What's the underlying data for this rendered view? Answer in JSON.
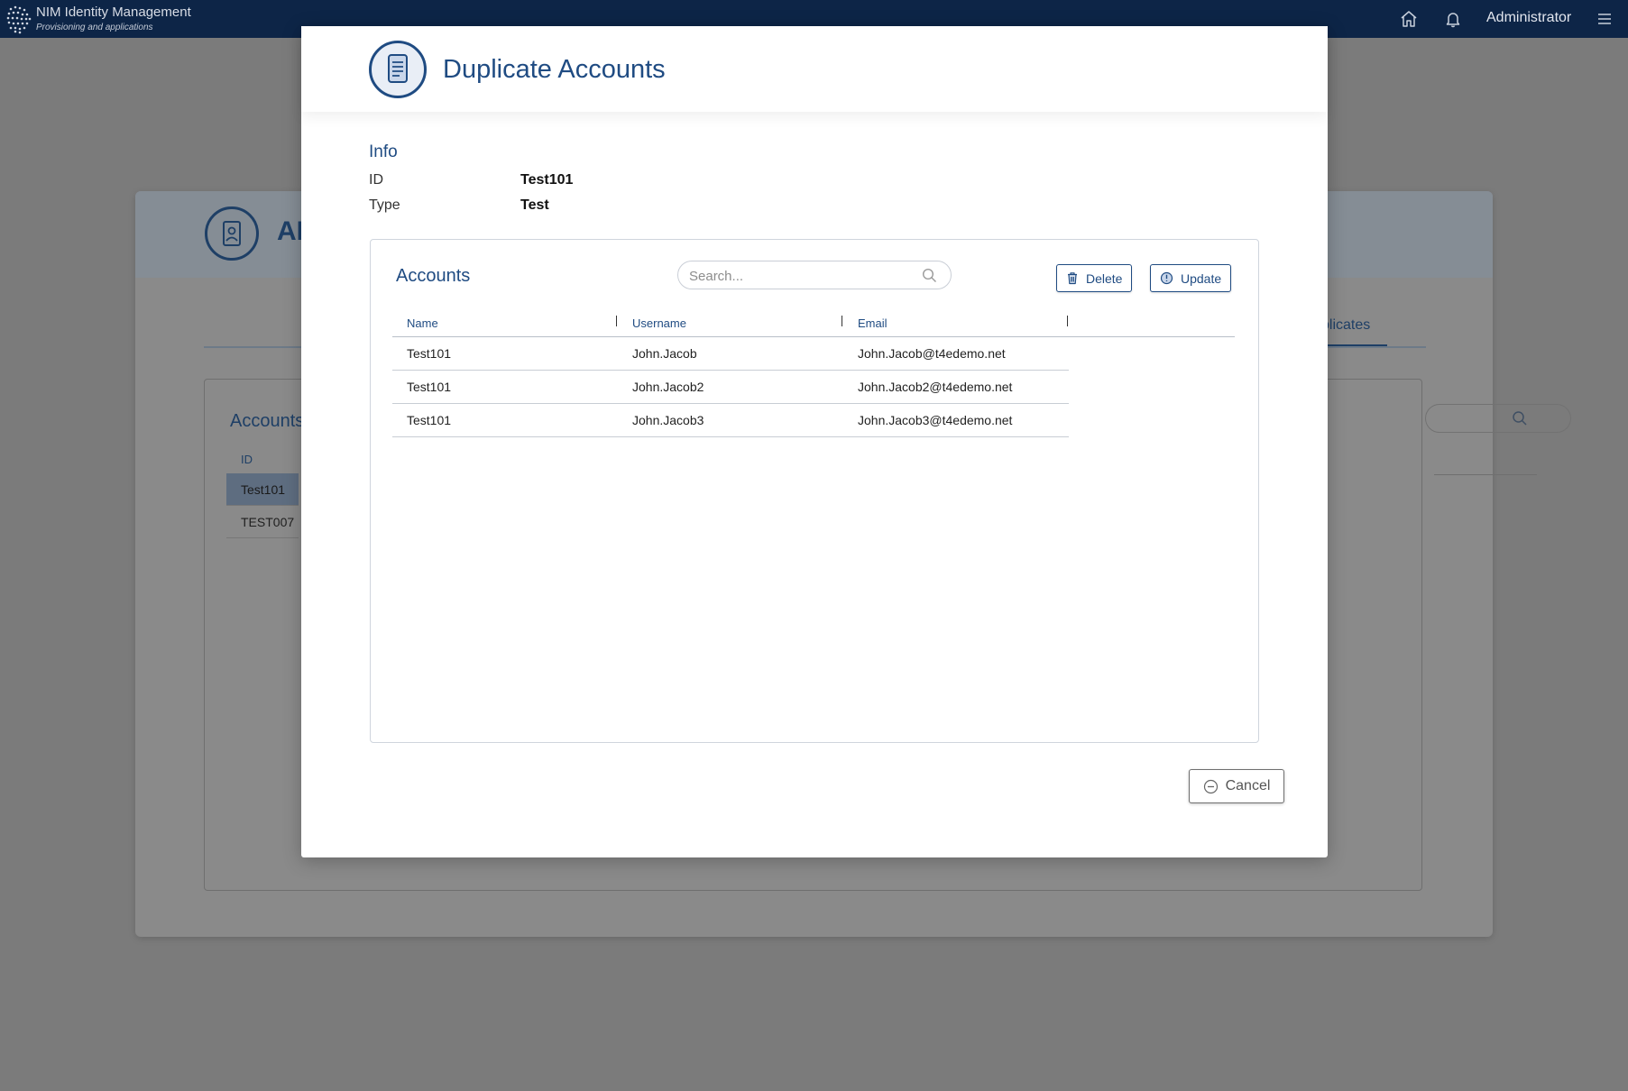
{
  "app": {
    "title": "NIM Identity Management",
    "subtitle": "Provisioning and applications",
    "user": "Administrator"
  },
  "background": {
    "page_title_fragment": "AD",
    "active_tab_fragment": "plicates",
    "accounts_title": "Accounts",
    "id_header": "ID",
    "rows": [
      "Test101",
      "TEST007"
    ]
  },
  "modal": {
    "title": "Duplicate Accounts",
    "info": {
      "heading": "Info",
      "id_label": "ID",
      "id_value": "Test101",
      "type_label": "Type",
      "type_value": "Test"
    },
    "accounts": {
      "title": "Accounts",
      "search_placeholder": "Search...",
      "delete_label": "Delete",
      "update_label": "Update",
      "columns": [
        "Name",
        "Username",
        "Email"
      ],
      "rows": [
        [
          "Test101",
          "John.Jacob",
          "John.Jacob@t4edemo.net"
        ],
        [
          "Test101",
          "John.Jacob2",
          "John.Jacob2@t4edemo.net"
        ],
        [
          "Test101",
          "John.Jacob3",
          "John.Jacob3@t4edemo.net"
        ]
      ]
    },
    "cancel_label": "Cancel"
  },
  "icons": {
    "top_home": "home-icon",
    "top_bell": "bell-icon",
    "top_menu": "hamburger-menu-icon",
    "modal_header": "document-icon",
    "search": "search-icon",
    "delete": "trash-icon",
    "update": "update-icon",
    "cancel": "minus-circle-icon"
  },
  "colors": {
    "topbar": "#0d2547",
    "accent": "#1f4b82",
    "overlay": "#7b7b7b"
  }
}
